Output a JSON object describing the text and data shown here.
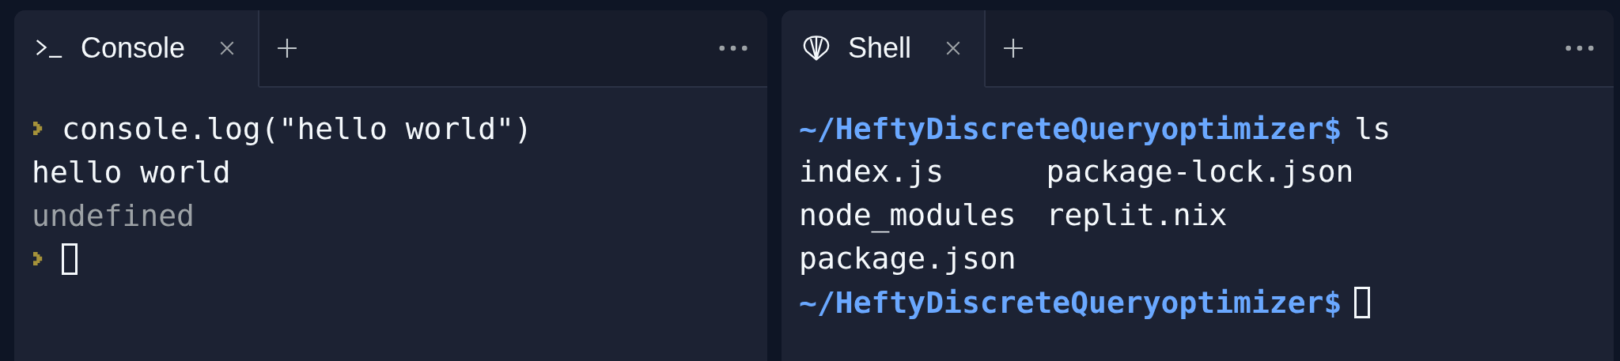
{
  "panels": [
    {
      "kind": "console",
      "tab": {
        "label": "Console",
        "selected": true
      },
      "lines": [
        {
          "kind": "input",
          "text": "console.log(\"hello world\")"
        },
        {
          "kind": "output",
          "text": "hello world"
        },
        {
          "kind": "result",
          "text": "undefined"
        },
        {
          "kind": "input",
          "cursor": true
        }
      ]
    },
    {
      "kind": "shell",
      "tab": {
        "label": "Shell",
        "selected": true
      },
      "lines": [
        {
          "kind": "prompt",
          "path": "~/HeftyDiscreteQueryoptimizer$",
          "command": "ls"
        },
        {
          "kind": "listing",
          "rows": [
            [
              "index.js",
              "package-lock.json"
            ],
            [
              "node_modules",
              "replit.nix"
            ],
            [
              "package.json"
            ]
          ]
        },
        {
          "kind": "prompt",
          "path": "~/HeftyDiscreteQueryoptimizer$",
          "cursor": true
        }
      ]
    }
  ]
}
